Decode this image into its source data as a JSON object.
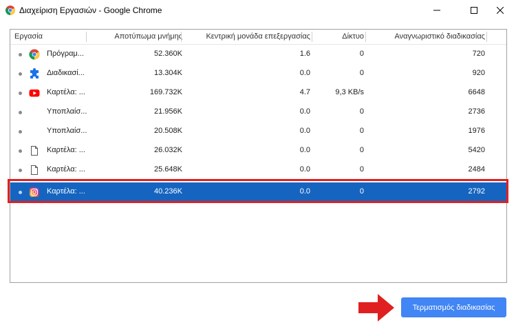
{
  "window": {
    "title": "Διαχείριση Εργασιών - Google Chrome",
    "app_icon": "chrome-icon",
    "controls": [
      "minimize-icon",
      "maximize-icon",
      "close-icon"
    ]
  },
  "table": {
    "columns": [
      "Εργασία",
      "Αποτύπωμα μνήμης",
      "Κεντρική μονάδα επεξεργασίας",
      "Δίκτυο",
      "Αναγνωριστικό διαδικασίας"
    ],
    "rows": [
      {
        "icon": "chrome-icon",
        "task": "Πρόγραμ...",
        "memory": "52.360K",
        "cpu": "1.6",
        "network": "0",
        "pid": "720"
      },
      {
        "icon": "puzzle-extension-icon",
        "task": "Διαδικασί...",
        "memory": "13.304K",
        "cpu": "0.0",
        "network": "0",
        "pid": "920"
      },
      {
        "icon": "youtube-icon",
        "task": "Καρτέλα: ...",
        "memory": "169.732K",
        "cpu": "4.7",
        "network": "9,3 KB/s",
        "pid": "6648"
      },
      {
        "icon": "",
        "task": "Υποπλαίσ...",
        "memory": "21.956K",
        "cpu": "0.0",
        "network": "0",
        "pid": "2736"
      },
      {
        "icon": "",
        "task": "Υποπλαίσ...",
        "memory": "20.508K",
        "cpu": "0.0",
        "network": "0",
        "pid": "1976"
      },
      {
        "icon": "document-icon",
        "task": "Καρτέλα: ...",
        "memory": "26.032K",
        "cpu": "0.0",
        "network": "0",
        "pid": "5420"
      },
      {
        "icon": "document-icon",
        "task": "Καρτέλα: ...",
        "memory": "25.648K",
        "cpu": "0.0",
        "network": "0",
        "pid": "2484"
      },
      {
        "icon": "instagram-icon",
        "task": "Καρτέλα: ...",
        "memory": "40.236K",
        "cpu": "0.0",
        "network": "0",
        "pid": "2792",
        "selected": true
      }
    ]
  },
  "footer": {
    "end_process_label": "Τερματισμός διαδικασίας",
    "arrow_color": "#e02020"
  },
  "colors": {
    "selection": "#1565c0",
    "button": "#4285f4",
    "highlight_border": "#e02020"
  }
}
